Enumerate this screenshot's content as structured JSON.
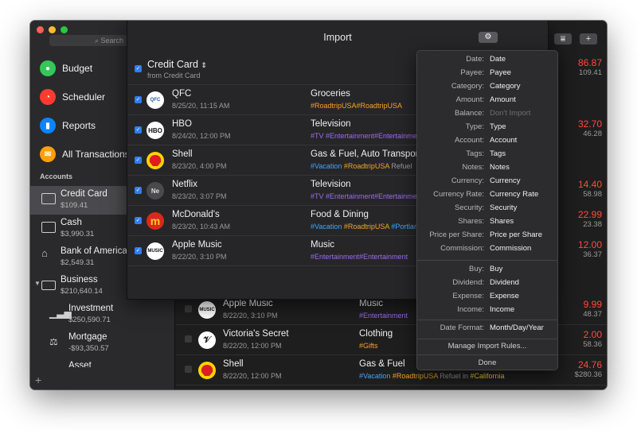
{
  "sidebar": {
    "search_placeholder": "Search",
    "nav": [
      {
        "label": "Budget",
        "color": "#34c759",
        "icon": "budget-icon"
      },
      {
        "label": "Scheduler",
        "color": "#ff3b30",
        "icon": "scheduler-icon"
      },
      {
        "label": "Reports",
        "color": "#0a84ff",
        "icon": "reports-icon"
      },
      {
        "label": "All Transactions",
        "color": "#ff9f0a",
        "icon": "all-transactions-icon"
      }
    ],
    "accounts_label": "Accounts",
    "accounts": [
      {
        "name": "Credit Card",
        "balance": "$109.41"
      },
      {
        "name": "Cash",
        "balance": "$3,990.31"
      },
      {
        "name": "Bank of America",
        "balance": "$2,549.31"
      },
      {
        "name": "Business",
        "balance": "$210,640.14"
      },
      {
        "name": "Investment",
        "balance": "$250,590.71"
      },
      {
        "name": "Mortgage",
        "balance": "-$93,350.57"
      },
      {
        "name": "Asset",
        "balance": ""
      }
    ]
  },
  "import": {
    "title": "Import",
    "account_name": "Credit Card",
    "account_source": "from Credit Card",
    "rows": [
      {
        "payee": "QFC",
        "date": "8/25/20, 11:15 AM",
        "category": "Groceries",
        "tags": "#RoadtripUSA#RoadtripUSA",
        "logo": "QFC"
      },
      {
        "payee": "HBO",
        "date": "8/24/20, 12:00 PM",
        "category": "Television",
        "tags": "#TV #Entertainment#Entertainment",
        "logo": "HBO"
      },
      {
        "payee": "Shell",
        "date": "8/23/20, 4:00 PM",
        "category": "Gas & Fuel, Auto Transport",
        "tags_a": "#Vacation ",
        "tags_b": "#RoadtripUSA ",
        "tags_c": "Refuel",
        "logo": ""
      },
      {
        "payee": "Netflix",
        "date": "8/23/20, 3:07 PM",
        "category": "Television",
        "tags": "#TV #Entertainment#Entertainment",
        "logo": "Ne"
      },
      {
        "payee": "McDonald's",
        "date": "8/23/20, 10:43 AM",
        "category": "Food & Dining",
        "tags_a": "#Vacation ",
        "tags_b": "#RoadtripUSA ",
        "tags_c": "#Portland",
        "logo": ""
      },
      {
        "payee": "Apple Music",
        "date": "8/22/20, 3:10 PM",
        "category": "Music",
        "tags": "#Entertainment#Entertainment",
        "logo": "MUSIC"
      }
    ]
  },
  "background_rows": [
    {
      "payee": "Apple Music",
      "date": "8/22/20, 3:10 PM",
      "category": "Music",
      "tags": "#Entertainment",
      "amount": "9.99",
      "balance": "48.37"
    },
    {
      "payee": "Victoria's Secret",
      "date": "8/22/20, 12:00 PM",
      "category": "Clothing",
      "tags": "#Gifts",
      "amount": "2.00",
      "balance": "58.36"
    },
    {
      "payee": "Shell",
      "date": "8/22/20, 12:00 PM",
      "category": "Gas & Fuel",
      "tags_a": "#Vacation ",
      "tags_b": "#RoadtripUSA ",
      "tags_c": "Refuel in ",
      "tags_d": "#California",
      "amount": "24.76",
      "balance": "$280.36"
    }
  ],
  "background_amounts": [
    {
      "amount": "86.87",
      "balance": "109.41"
    },
    {
      "amount": "32.70",
      "balance": "46.28"
    },
    {
      "amount": "14.40",
      "balance": "58.98"
    },
    {
      "amount": "22.99",
      "balance": "23.38"
    },
    {
      "amount": "12.00",
      "balance": "36.37"
    }
  ],
  "mapping": {
    "fields": [
      {
        "key": "Date:",
        "value": "Date"
      },
      {
        "key": "Payee:",
        "value": "Payee"
      },
      {
        "key": "Category:",
        "value": "Category"
      },
      {
        "key": "Amount:",
        "value": "Amount"
      },
      {
        "key": "Balance:",
        "value": "Don't Import",
        "dim": true
      },
      {
        "key": "Type:",
        "value": "Type"
      },
      {
        "key": "Account:",
        "value": "Account"
      },
      {
        "key": "Tags:",
        "value": "Tags"
      },
      {
        "key": "Notes:",
        "value": "Notes"
      },
      {
        "key": "Currency:",
        "value": "Currency"
      },
      {
        "key": "Currency Rate:",
        "value": "Currency Rate"
      },
      {
        "key": "Security:",
        "value": "Security"
      },
      {
        "key": "Shares:",
        "value": "Shares"
      },
      {
        "key": "Price per Share:",
        "value": "Price per Share"
      },
      {
        "key": "Commission:",
        "value": "Commission"
      }
    ],
    "types": [
      {
        "key": "Buy:",
        "value": "Buy"
      },
      {
        "key": "Dividend:",
        "value": "Dividend"
      },
      {
        "key": "Expense:",
        "value": "Expense"
      },
      {
        "key": "Income:",
        "value": "Income"
      }
    ],
    "date_format_label": "Date Format:",
    "date_format_value": "Month/Day/Year",
    "manage_rules": "Manage Import Rules...",
    "done": "Done"
  }
}
